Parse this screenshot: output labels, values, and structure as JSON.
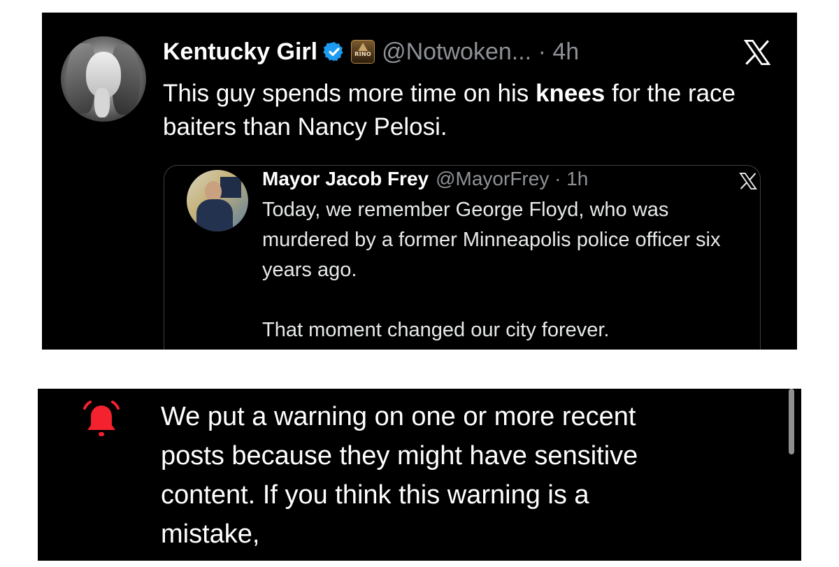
{
  "tweet": {
    "author_name": "Kentucky Girl",
    "badge_text": "RINO",
    "handle_meta": "@Notwoken... · 4h",
    "text_before": "This guy spends more time on his ",
    "text_bold": "knees",
    "text_after": " for the race baiters than Nancy Pelosi.",
    "icons": {
      "verified": "verified-badge-icon",
      "platform": "x-logo-icon"
    },
    "colors": {
      "verified": "#1d9bf0"
    }
  },
  "quote": {
    "author_name": "Mayor Jacob Frey",
    "handle_meta": "@MayorFrey · 1h",
    "text": "Today, we remember George Floyd, who was murdered by a former Minneapolis police officer six years ago.\n\nThat moment changed our city forever."
  },
  "notice": {
    "text": "We put a warning on one or more recent posts because they might have sensitive content. If you think this warning is a mistake,",
    "icon": "bell-icon",
    "color": "#f4212e"
  }
}
